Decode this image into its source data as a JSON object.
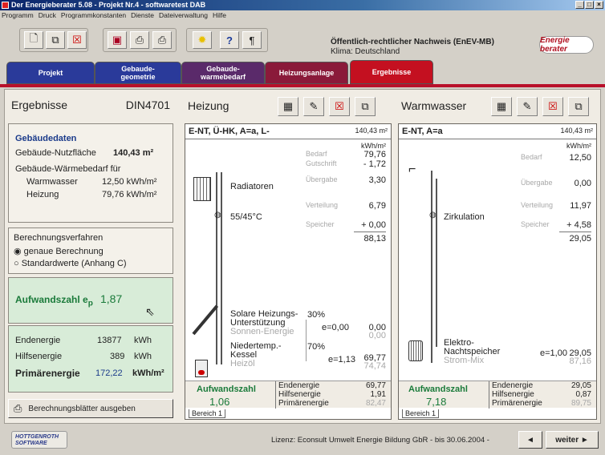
{
  "window": {
    "title": "Der Energieberater 5.08  -  Projekt Nr.4  -  softwaretest DAB"
  },
  "menu": [
    "Programm",
    "Druck",
    "Programmkonstanten",
    "Dienste",
    "Dateiverwaltung",
    "Hilfe"
  ],
  "toolbar": {
    "icons": [
      "new-doc-icon",
      "open-doc-icon",
      "delete-doc-icon",
      "save-icon",
      "print-icon",
      "print-preview-icon",
      "sun-icon",
      "help-icon",
      "paragraph-icon"
    ]
  },
  "header": {
    "line1": "Öffentlich-rechtlicher Nachweis (EnEV-MB)",
    "line2": "Klima: Deutschland",
    "logo": "Energie berater"
  },
  "tabs": [
    {
      "label1": "Projekt",
      "label2": "",
      "color": "#2a3a9a"
    },
    {
      "label1": "Gebaude-",
      "label2": "geometrie",
      "color": "#2a3a9a"
    },
    {
      "label1": "Gebaude-",
      "label2": "warmebedarf",
      "color": "#5a2a6a"
    },
    {
      "label1": "Heizungsanlage",
      "label2": "",
      "color": "#8a1a3a"
    },
    {
      "label1": "Ergebnisse",
      "label2": "",
      "color": "#c41020"
    }
  ],
  "left": {
    "title": "Ergebnisse",
    "standard": "DIN4701",
    "gebaeudedaten": {
      "heading": "Gebäudedaten",
      "nf_label": "Gebäude-Nutzfläche",
      "nf_value": "140,43 m²",
      "wb_label": "Gebäude-Wärmebedarf für",
      "ww_label": "Warmwasser",
      "ww_value": "12,50 kWh/m²",
      "hz_label": "Heizung",
      "hz_value": "79,76 kWh/m²"
    },
    "verfahren": {
      "heading": "Berechnungsverfahren",
      "opt1": "genaue Berechnung",
      "opt2": "Standardwerte (Anhang C)",
      "selected": 0
    },
    "aufwand": {
      "label": "Aufwandszahl e",
      "sub": "p",
      "value": "1,87"
    },
    "energie": [
      {
        "label": "Endenergie",
        "value": "13877",
        "unit": "kWh"
      },
      {
        "label": "Hilfsenergie",
        "value": "389",
        "unit": "kWh"
      },
      {
        "label": "Primärenergie",
        "value": "172,22",
        "unit": "kWh/m²"
      }
    ],
    "button": "Berechnungsblätter ausgeben"
  },
  "heizung": {
    "title": "Heizung",
    "box_title": "E-NT, Ü-HK, A=a, L-",
    "area": "140,43 m²",
    "unit": "kWh/m²",
    "labels": {
      "bedarf": "Bedarf",
      "gutschrift": "Gutschrift",
      "uebergabe": "Übergabe",
      "verteilung": "Verteilung",
      "speicher": "Speicher"
    },
    "values": {
      "bedarf": "79,76",
      "gutschrift": "- 1,72",
      "uebergabe": "3,30",
      "verteilung": "6,79",
      "speicher": "+ 0,00",
      "sum": "88,13"
    },
    "radiatoren": "Radiatoren",
    "temp": "55/45°C",
    "solar": {
      "l1": "Solare Heizungs-",
      "l2": "Unterstützung",
      "src": "Sonnen-Energie",
      "pct": "30%",
      "e": "e=0,00",
      "v1": "0,00",
      "v2": "0,00"
    },
    "kessel": {
      "l1": "Niedertemp.-",
      "l2": "Kessel",
      "src": "Heizöl",
      "pct": "70%",
      "e": "e=1,13",
      "v1": "69,77",
      "v2": "74,74"
    },
    "aufwand_label": "Aufwandszahl",
    "aufwand_value": "1,06",
    "end_label": "Endenergie",
    "end_value": "69,77",
    "hilf_label": "Hilfsenergie",
    "hilf_value": "1,91",
    "prim_label": "Primärenergie",
    "prim_value": "82,47",
    "bereich": "Bereich 1"
  },
  "warmwasser": {
    "title": "Warmwasser",
    "box_title": "E-NT, A=a",
    "area": "140,43 m²",
    "unit": "kWh/m²",
    "labels": {
      "bedarf": "Bedarf",
      "uebergabe": "Übergabe",
      "verteilung": "Verteilung",
      "speicher": "Speicher"
    },
    "values": {
      "bedarf": "12,50",
      "uebergabe": "0,00",
      "verteilung": "11,97",
      "speicher": "+ 4,58",
      "sum": "29,05"
    },
    "zirkulation": "Zirkulation",
    "speicher": {
      "l1": "Elektro-",
      "l2": "Nachtspeicher",
      "src": "Strom-Mix",
      "e": "e=1,00",
      "v1": "29,05",
      "v2": "87,16"
    },
    "aufwand_label": "Aufwandszahl",
    "aufwand_value": "7,18",
    "end_label": "Endenergie",
    "end_value": "29,05",
    "hilf_label": "Hilfsenergie",
    "hilf_value": "0,87",
    "prim_label": "Primärenergie",
    "prim_value": "89,75",
    "bereich": "Bereich 1"
  },
  "footer": {
    "logo1": "HOTTGENROTH",
    "logo2": "SOFTWARE",
    "license": "Lizenz: Econsult Umwelt Energie Bildung GbR - bis 30.06.2004 -",
    "back": "◄",
    "next": "weiter ►"
  }
}
